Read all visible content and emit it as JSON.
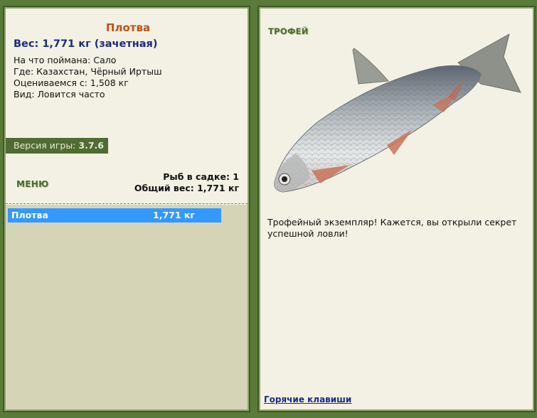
{
  "fish": {
    "name": "Плотва",
    "weight_line": "Вес: 1,771 кг (зачетная)",
    "bait": "На что поймана: Сало",
    "location": "Где: Казахстан, Чёрный Иртыш",
    "valued_from": "Оцениваемся с: 1,508 кг",
    "kind": "Вид: Ловится часто"
  },
  "version": {
    "label": "Версия игры:",
    "value": "3.7.6"
  },
  "menu_label": "МЕНЮ",
  "keepnet": {
    "count": "Рыб в садке: 1",
    "total": "Общий вес: 1,771 кг"
  },
  "catch_list": [
    {
      "name": "Плотва",
      "weight": "1,771 кг"
    }
  ],
  "trophy": {
    "title": "ТРОФЕЙ",
    "description": "Трофейный экземпляр! Кажется, вы открыли секрет успешной ловли!"
  },
  "hotkeys_label": "Горячие клавиши",
  "colors": {
    "frame": "#5a7a3a",
    "panel": "#f3f1e3",
    "accent": "#c0501a",
    "selection": "#3399ff"
  }
}
